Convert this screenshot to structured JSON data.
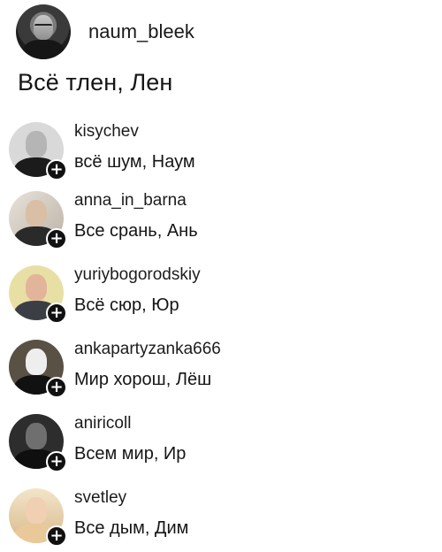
{
  "post": {
    "author": "naum_bleek",
    "caption": "Всё тлен, Лен"
  },
  "comments": [
    {
      "username": "kisychev",
      "text": "всё шум, Наум",
      "badge": "+"
    },
    {
      "username": "anna_in_barna",
      "text": "Все срань, Ань",
      "badge": "+"
    },
    {
      "username": "yuriybogorodskiy",
      "text": "Всё сюр, Юр",
      "badge": "+"
    },
    {
      "username": "ankapartyzanka666",
      "text": "Мир хорош, Лёш",
      "badge": "+"
    },
    {
      "username": "aniricoll",
      "text": "Всем мир, Ир",
      "badge": "+"
    },
    {
      "username": "svetley",
      "text": "Все дым, Дим",
      "badge": "+"
    }
  ]
}
